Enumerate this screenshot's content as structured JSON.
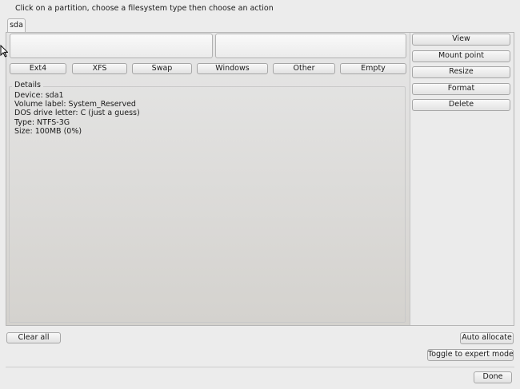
{
  "instruction": "Click on a partition, choose a filesystem type then choose an action",
  "tabs": [
    {
      "label": "sda"
    }
  ],
  "filesystem_buttons": [
    {
      "label": "Ext4"
    },
    {
      "label": "XFS"
    },
    {
      "label": "Swap"
    },
    {
      "label": "Windows"
    },
    {
      "label": "Other"
    },
    {
      "label": "Empty"
    }
  ],
  "actions": {
    "view": "View",
    "mount_point": "Mount point",
    "resize": "Resize",
    "format": "Format",
    "delete": "Delete"
  },
  "details": {
    "title": "Details",
    "device": "Device: sda1",
    "volume_label": "Volume label: System_Reserved",
    "dos_drive": "DOS drive letter: C (just a guess)",
    "type": "Type: NTFS-3G",
    "size": "Size: 100MB (0%)"
  },
  "bottom": {
    "clear_all": "Clear all",
    "auto_allocate": "Auto allocate",
    "toggle_expert": "Toggle to expert mode",
    "done": "Done"
  }
}
